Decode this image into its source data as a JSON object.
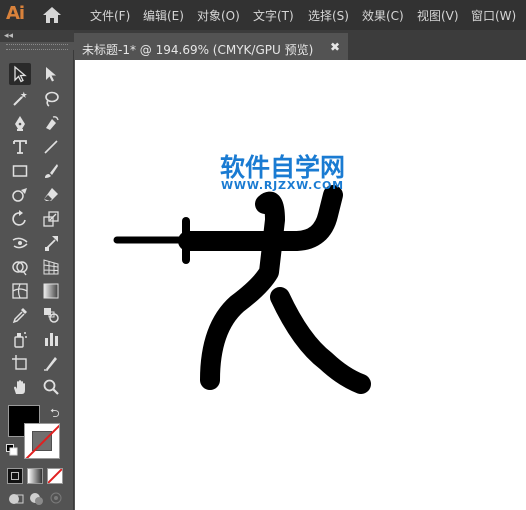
{
  "app": {
    "logo": "Ai",
    "home_icon": "home-icon"
  },
  "menu": [
    {
      "label": "文件(F)"
    },
    {
      "label": "编辑(E)"
    },
    {
      "label": "对象(O)"
    },
    {
      "label": "文字(T)"
    },
    {
      "label": "选择(S)"
    },
    {
      "label": "效果(C)"
    },
    {
      "label": "视图(V)"
    },
    {
      "label": "窗口(W)"
    }
  ],
  "panel": {
    "collapse_label": "◂◂"
  },
  "document": {
    "tab_title": "未标题-1* @ 194.69% (CMYK/GPU 预览)",
    "close_label": "✖"
  },
  "watermark": {
    "title": "软件自学网",
    "url": "WWW.RJZXW.COM",
    "color": "#1a7bd2"
  },
  "tools": [
    "selection-tool",
    "direct-selection-tool",
    "magic-wand-tool",
    "lasso-tool",
    "pen-tool",
    "curvature-tool",
    "type-tool",
    "line-segment-tool",
    "rectangle-tool",
    "paintbrush-tool",
    "shaper-tool",
    "eraser-tool",
    "rotate-tool",
    "scale-tool",
    "width-tool",
    "free-transform-tool",
    "shape-builder-tool",
    "perspective-grid-tool",
    "mesh-tool",
    "gradient-tool",
    "eyedropper-tool",
    "blend-tool",
    "symbol-sprayer-tool",
    "column-graph-tool",
    "artboard-tool",
    "slice-tool",
    "hand-tool",
    "zoom-tool"
  ],
  "colors": {
    "fill": "#000000",
    "stroke": "none",
    "ui_dark": "#323232",
    "ui_panel": "#535353"
  }
}
